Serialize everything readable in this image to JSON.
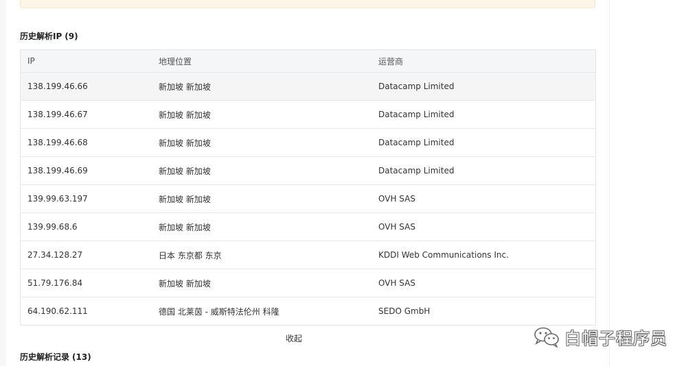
{
  "history_ip": {
    "title": "历史解析IP",
    "count": "(9)",
    "columns": [
      "IP",
      "地理位置",
      "运营商"
    ],
    "rows": [
      {
        "ip": "138.199.46.66",
        "location": "新加坡 新加坡",
        "isp": "Datacamp Limited"
      },
      {
        "ip": "138.199.46.67",
        "location": "新加坡 新加坡",
        "isp": "Datacamp Limited"
      },
      {
        "ip": "138.199.46.68",
        "location": "新加坡 新加坡",
        "isp": "Datacamp Limited"
      },
      {
        "ip": "138.199.46.69",
        "location": "新加坡 新加坡",
        "isp": "Datacamp Limited"
      },
      {
        "ip": "139.99.63.197",
        "location": "新加坡 新加坡",
        "isp": "OVH SAS"
      },
      {
        "ip": "139.99.68.6",
        "location": "新加坡 新加坡",
        "isp": "OVH SAS"
      },
      {
        "ip": "27.34.128.27",
        "location": "日本 东京都 东京",
        "isp": "KDDI Web Communications Inc."
      },
      {
        "ip": "51.79.176.84",
        "location": "新加坡 新加坡",
        "isp": "OVH SAS"
      },
      {
        "ip": "64.190.62.111",
        "location": "德国 北莱茵 - 威斯特法伦州 科隆",
        "isp": "SEDO GmbH"
      }
    ],
    "collapse_label": "收起"
  },
  "history_records": {
    "title": "历史解析记录",
    "count": "(13)"
  },
  "watermark": {
    "text": "白帽子程序员",
    "icon": "wechat-icon"
  },
  "colors": {
    "notice_bg": "#fdf6e8",
    "header_bg": "#f5f6f7",
    "row_hover_bg": "#f5f5f5",
    "border": "#e5e5e5"
  }
}
